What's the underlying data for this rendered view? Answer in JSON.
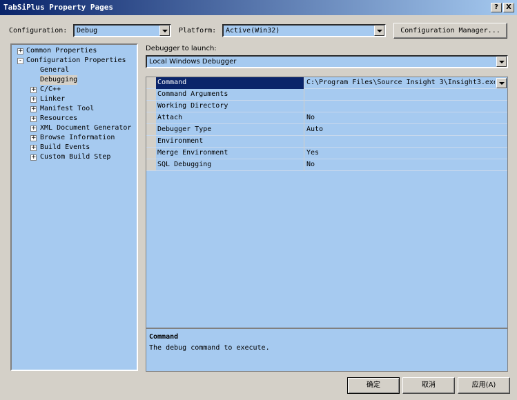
{
  "window": {
    "title": "TabSiPlus Property Pages",
    "help_button": "?",
    "close_button": "X"
  },
  "toolbar": {
    "configuration_label": "Configuration:",
    "configuration_value": "Debug",
    "platform_label": "Platform:",
    "platform_value": "Active(Win32)",
    "config_manager_button": "Configuration Manager..."
  },
  "tree": {
    "items": [
      {
        "label": "Common Properties",
        "expander": "+"
      },
      {
        "label": "Configuration Properties",
        "expander": "-"
      },
      {
        "label": "General"
      },
      {
        "label": "Debugging"
      },
      {
        "label": "C/C++",
        "expander": "+"
      },
      {
        "label": "Linker",
        "expander": "+"
      },
      {
        "label": "Manifest Tool",
        "expander": "+"
      },
      {
        "label": "Resources",
        "expander": "+"
      },
      {
        "label": "XML Document Generator",
        "expander": "+"
      },
      {
        "label": "Browse Information",
        "expander": "+"
      },
      {
        "label": "Build Events",
        "expander": "+"
      },
      {
        "label": "Custom Build Step",
        "expander": "+"
      }
    ]
  },
  "debugger": {
    "label": "Debugger to launch:",
    "value": "Local Windows Debugger"
  },
  "grid": {
    "rows": [
      {
        "name": "Command",
        "value": "C:\\Program Files\\Source Insight 3\\Insight3.exe"
      },
      {
        "name": "Command Arguments",
        "value": ""
      },
      {
        "name": "Working Directory",
        "value": ""
      },
      {
        "name": "Attach",
        "value": "No"
      },
      {
        "name": "Debugger Type",
        "value": "Auto"
      },
      {
        "name": "Environment",
        "value": ""
      },
      {
        "name": "Merge Environment",
        "value": "Yes"
      },
      {
        "name": "SQL Debugging",
        "value": "No"
      }
    ]
  },
  "description": {
    "title": "Command",
    "text": "The debug command to execute."
  },
  "buttons": {
    "ok": "确定",
    "cancel": "取消",
    "apply": "应用(A)"
  },
  "colors": {
    "panel": "#a6caf0",
    "selection": "#0a246a",
    "face": "#d4d0c8"
  }
}
